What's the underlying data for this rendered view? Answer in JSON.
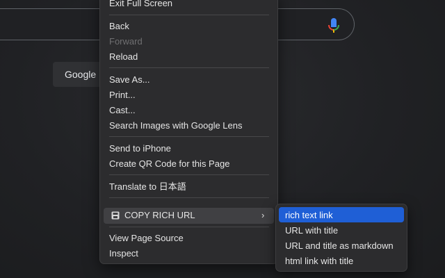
{
  "background": {
    "google_button_label": "Google"
  },
  "context_menu": {
    "items": [
      {
        "label": "Exit Full Screen"
      },
      {
        "label": "Back"
      },
      {
        "label": "Forward",
        "disabled": true
      },
      {
        "label": "Reload"
      },
      {
        "label": "Save As..."
      },
      {
        "label": "Print..."
      },
      {
        "label": "Cast..."
      },
      {
        "label": "Search Images with Google Lens"
      },
      {
        "label": "Send to iPhone"
      },
      {
        "label": "Create QR Code for this Page"
      },
      {
        "label": "Translate to 日本語"
      },
      {
        "label": "COPY RICH URL",
        "has_submenu": true,
        "icon": "extension-icon"
      },
      {
        "label": "View Page Source"
      },
      {
        "label": "Inspect"
      }
    ]
  },
  "submenu": {
    "items": [
      {
        "label": "rich text link",
        "highlighted": true
      },
      {
        "label": "URL with title"
      },
      {
        "label": "URL and title as markdown"
      },
      {
        "label": "html link with title"
      }
    ]
  },
  "colors": {
    "highlight": "#1f5fd6",
    "menu_background": "#2c2c2e",
    "page_background": "#202124"
  }
}
